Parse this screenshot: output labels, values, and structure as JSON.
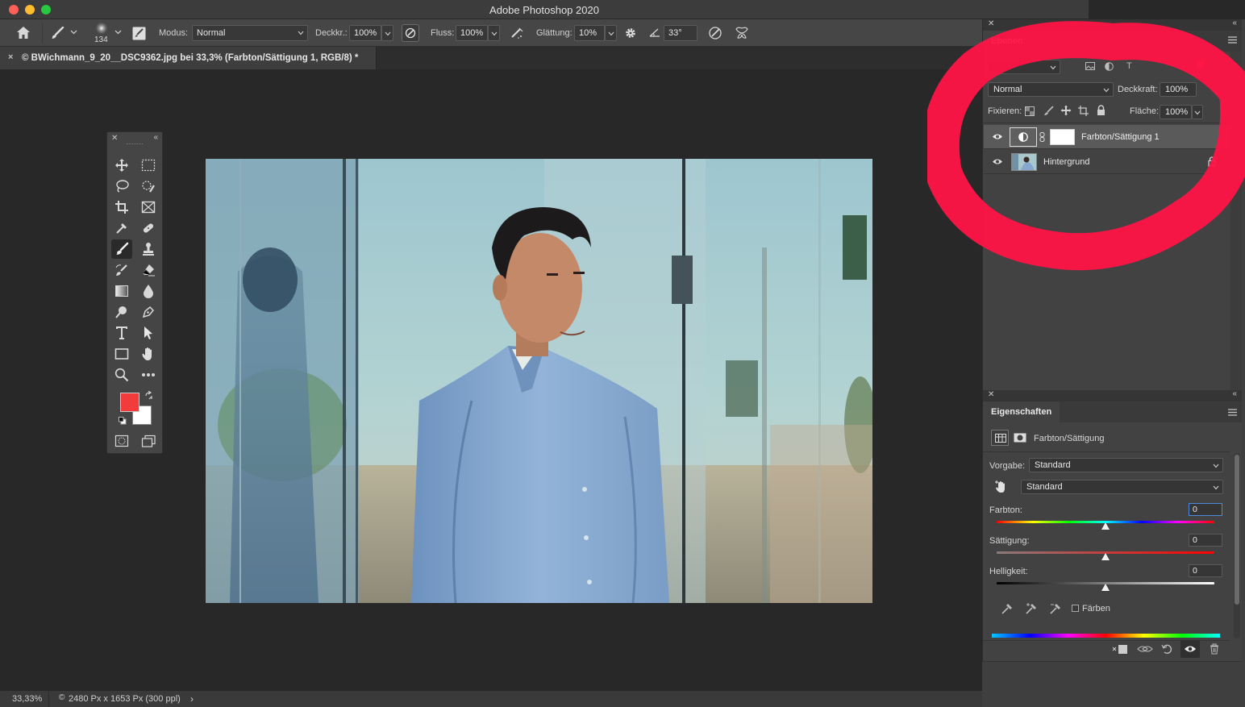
{
  "window": {
    "title": "Adobe Photoshop 2020"
  },
  "options_bar": {
    "brush_size": "134",
    "mode_label": "Modus:",
    "mode_value": "Normal",
    "opacity_label": "Deckkr.:",
    "opacity_value": "100%",
    "flow_label": "Fluss:",
    "flow_value": "100%",
    "smoothing_label": "Glättung:",
    "smoothing_value": "10%",
    "angle_value": "33°"
  },
  "document": {
    "tab_close": "×",
    "tab_label": "© BWichmann_9_20__DSC9362.jpg bei 33,3% (Farbton/Sättigung 1, RGB/8) *"
  },
  "status": {
    "zoom": "33,33%",
    "doc_info": "2480 Px x 1653 Px (300 ppl)",
    "arrow": "›"
  },
  "layers_panel": {
    "tab": "Ebenen",
    "blend_mode": "Normal",
    "opacity_label": "Deckkraft:",
    "opacity_value": "100%",
    "lock_label": "Fixieren:",
    "fill_label": "Fläche:",
    "fill_value": "100%",
    "layers": [
      {
        "name": "Farbton/Sättigung 1",
        "visible": true,
        "selected": true
      },
      {
        "name": "Hintergrund",
        "visible": true,
        "locked": true
      }
    ]
  },
  "properties_panel": {
    "tab": "Eigenschaften",
    "adjustment_title": "Farbton/Sättigung",
    "preset_label": "Vorgabe:",
    "preset_value": "Standard",
    "channel_value": "Standard",
    "hue_label": "Farbton:",
    "hue_value": "0",
    "saturation_label": "Sättigung:",
    "saturation_value": "0",
    "lightness_label": "Helligkeit:",
    "lightness_value": "0",
    "colorize_label": "Färben",
    "colorize_checked": false
  },
  "colors": {
    "foreground": "#f23b3b",
    "background": "#ffffff",
    "annotation": "#ff1446"
  }
}
